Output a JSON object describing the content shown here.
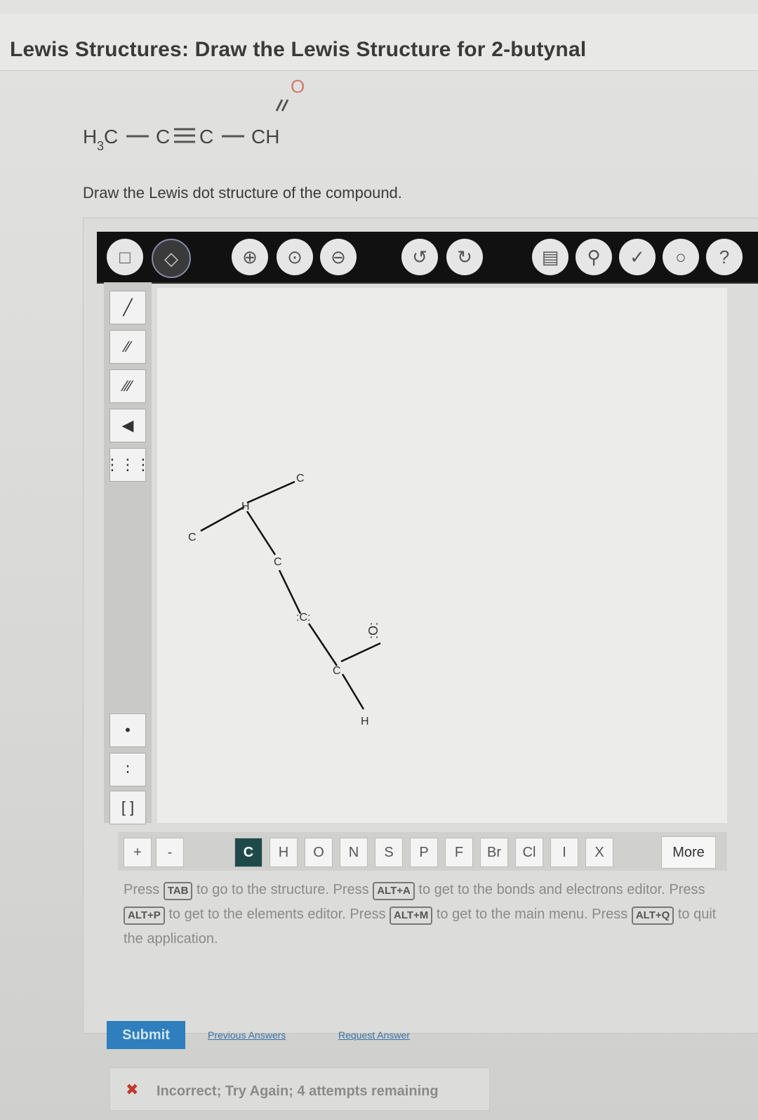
{
  "header": {
    "title": "Lewis Structures: Draw the Lewis Structure for 2-butynal"
  },
  "formula": {
    "h3c_h": "H",
    "h3c_sub": "3",
    "h3c_c": "C",
    "c2": "C",
    "c3": "C",
    "ch": "CH",
    "oxygen": "O"
  },
  "instruction": "Draw the Lewis dot structure of the compound.",
  "toolbar": {
    "icons": [
      "select-icon",
      "eraser-icon",
      "zoom-in-icon",
      "zoom-reset-icon",
      "zoom-out-icon",
      "undo-icon",
      "redo-icon",
      "template-icon",
      "hint-icon",
      "check-icon",
      "cleanup-icon",
      "help-icon"
    ],
    "help_label": "?"
  },
  "left_tools": {
    "bonds": [
      "single-bond-icon",
      "double-bond-icon",
      "triple-bond-icon",
      "wedge-bond-icon",
      "hash-bond-icon"
    ],
    "electrons": [
      "lone-electron-icon",
      "electron-pair-icon",
      "bracket-icon"
    ],
    "bracket_label": "[ ]"
  },
  "drawing": {
    "atoms": [
      {
        "id": "c1",
        "label": "C"
      },
      {
        "id": "h1",
        "label": "H"
      },
      {
        "id": "c2",
        "label": "C"
      },
      {
        "id": "c3",
        "label": "C"
      },
      {
        "id": "c4",
        "label": ":C:"
      },
      {
        "id": "c5",
        "label": "C"
      },
      {
        "id": "o1",
        "label": ":O:"
      },
      {
        "id": "h2",
        "label": "H"
      }
    ]
  },
  "elements": {
    "items": [
      "C",
      "H",
      "O",
      "N",
      "S",
      "P",
      "F",
      "Br",
      "Cl",
      "I",
      "X"
    ],
    "selected": "C",
    "plus_label": "+",
    "minus_label": "-",
    "more_label": "More"
  },
  "help": {
    "press1": "Press",
    "tab_key": "TAB",
    "t1": "to go to the structure. Press",
    "alta_key": "ALT+A",
    "t2": "to get to the bonds and electrons editor. Press",
    "altp_key": "ALT+P",
    "t3": "to get to the elements editor. Press",
    "altm_key": "ALT+M",
    "t4": "to get to the main menu. Press",
    "altq_key": "ALT+Q",
    "t5": "to quit the application."
  },
  "actions": {
    "submit_label": "Submit",
    "previous_answers": "Previous Answers",
    "request_answer": "Request Answer"
  },
  "feedback": {
    "icon": "x-icon",
    "message": "Incorrect; Try Again; 4 attempts remaining"
  }
}
